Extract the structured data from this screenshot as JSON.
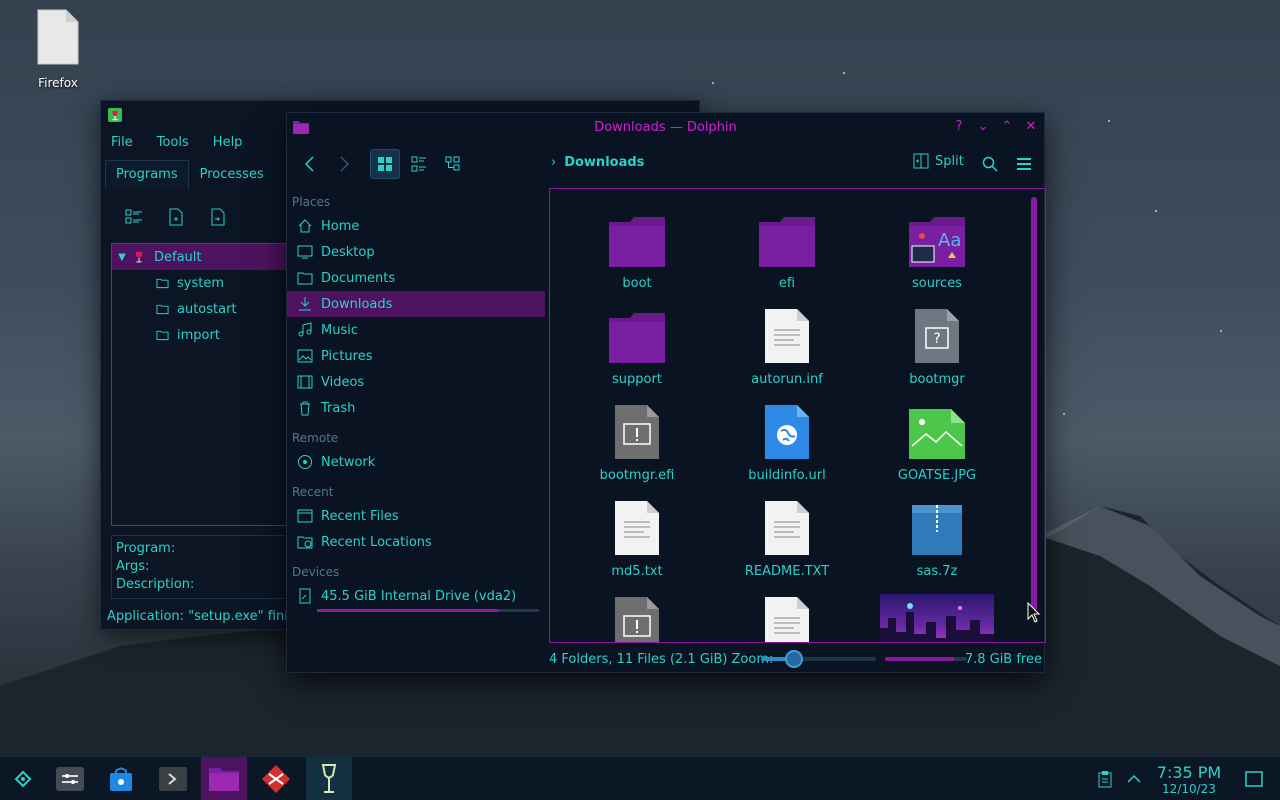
{
  "desktop": {
    "icon_label": "Firefox"
  },
  "backwin": {
    "menu": [
      "File",
      "Tools",
      "Help"
    ],
    "tabs": [
      "Programs",
      "Processes"
    ],
    "tree": [
      "Default",
      "system",
      "autostart",
      "import"
    ],
    "props": [
      "Program:",
      "Args:",
      "Description:"
    ],
    "status": "Application: \"setup.exe\" finish"
  },
  "dolphin": {
    "title": "Downloads — Dolphin",
    "window_controls": [
      "?",
      "⌄",
      "⌃",
      "✕"
    ],
    "breadcrumb": "Downloads",
    "split_label": "Split",
    "places": {
      "sections": {
        "places": "Places",
        "remote": "Remote",
        "recent": "Recent",
        "devices": "Devices"
      },
      "items": [
        "Home",
        "Desktop",
        "Documents",
        "Downloads",
        "Music",
        "Pictures",
        "Videos",
        "Trash"
      ],
      "remote": [
        "Network"
      ],
      "recent": [
        "Recent Files",
        "Recent Locations"
      ],
      "devices": [
        "45.5 GiB Internal Drive (vda2)"
      ]
    },
    "files": [
      {
        "name": "boot",
        "icon": "folder-icon"
      },
      {
        "name": "efi",
        "icon": "folder-icon"
      },
      {
        "name": "sources",
        "icon": "folder-icon"
      },
      {
        "name": "support",
        "icon": "folder-icon"
      },
      {
        "name": "autorun.inf",
        "icon": "text-file-icon"
      },
      {
        "name": "bootmgr",
        "icon": "unknown-file-icon"
      },
      {
        "name": "bootmgr.efi",
        "icon": "executable-file-icon"
      },
      {
        "name": "buildinfo.url",
        "icon": "url-file-icon"
      },
      {
        "name": "GOATSE.JPG",
        "icon": "image-file-icon"
      },
      {
        "name": "md5.txt",
        "icon": "text-file-icon"
      },
      {
        "name": "README.TXT",
        "icon": "text-file-icon"
      },
      {
        "name": "sas.7z",
        "icon": "archive-file-icon"
      }
    ],
    "status_summary": "4 Folders, 11 Files (2.1 GiB)",
    "zoom_label": "Zoom:",
    "free_space": "7.8 GiB free"
  },
  "taskbar": {
    "time": "7:35 PM",
    "date": "12/10/23"
  },
  "colors": {
    "accent": "#d21fd6",
    "text": "#2ad2c9",
    "selection": "#4e1360",
    "border": "#8a1aa6"
  }
}
